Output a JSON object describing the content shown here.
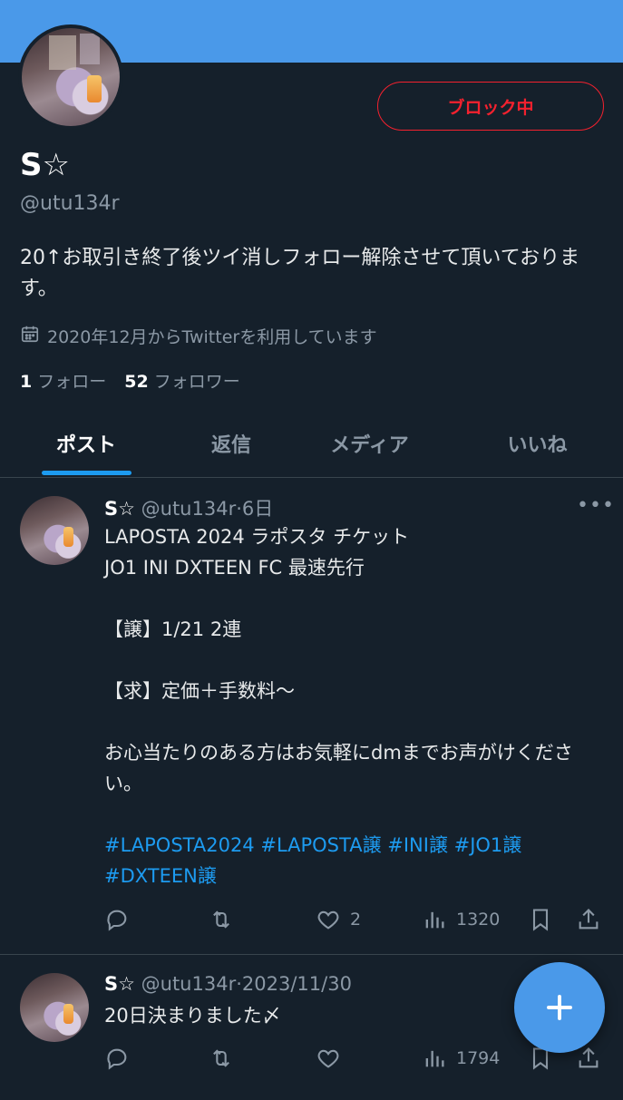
{
  "profile": {
    "name": "S☆",
    "handle": "@utu134r",
    "block_label": "ブロック中",
    "bio": "20↑お取引き終了後ツイ消しフォロー解除させて頂いております。",
    "joined": "2020年12月からTwitterを利用しています",
    "following_count": "1",
    "following_label": "フォロー",
    "followers_count": "52",
    "followers_label": "フォロワー"
  },
  "tabs": [
    {
      "label": "ポスト",
      "active": true
    },
    {
      "label": "返信",
      "active": false
    },
    {
      "label": "メディア",
      "active": false
    },
    {
      "label": "いいね",
      "active": false
    }
  ],
  "tweets": [
    {
      "name": "S☆",
      "handle": "@utu134r",
      "time": "6日",
      "lines": [
        "LAPOSTA 2024 ラポスタ チケット",
        "JO1 INI DXTEEN FC 最速先行",
        "",
        "【譲】1/21 2連",
        "",
        "【求】定価＋手数料〜",
        "",
        "お心当たりのある方はお気軽にdmまでお声がけください。"
      ],
      "hashtags": "#LAPOSTA2024 #LAPOSTA譲 #INI譲 #JO1譲 #DXTEEN譲",
      "replies": "",
      "retweets": "",
      "likes": "2",
      "views": "1320"
    },
    {
      "name": "S☆",
      "handle": "@utu134r",
      "time": "2023/11/30",
      "lines": [
        "20日決まりました〆"
      ],
      "hashtags": "",
      "replies": "",
      "retweets": "",
      "likes": "",
      "views": "1794"
    }
  ],
  "icons": {
    "calendar": "calendar-icon",
    "more": "more-icon",
    "reply": "reply-icon",
    "retweet": "retweet-icon",
    "like": "heart-icon",
    "views": "views-icon",
    "bookmark": "bookmark-icon",
    "share": "share-icon",
    "compose": "compose-plus-icon"
  },
  "colors": {
    "banner": "#4a99e9",
    "background": "#15202b",
    "block": "#f4212e",
    "link": "#1d9bf0",
    "secondary_text": "#8b98a5"
  }
}
